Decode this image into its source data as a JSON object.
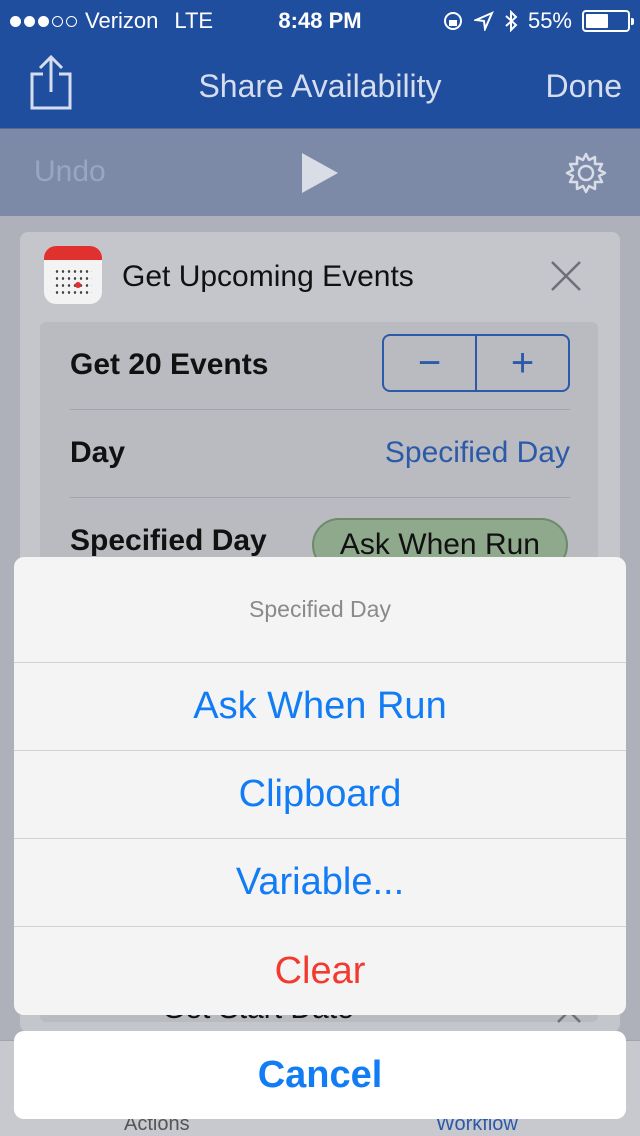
{
  "status_bar": {
    "carrier": "Verizon",
    "network": "LTE",
    "time": "8:48 PM",
    "battery": "55%",
    "battery_level": 0.55
  },
  "nav": {
    "title": "Share Availability",
    "done_label": "Done",
    "share_icon": "share-icon"
  },
  "toolbar": {
    "undo_label": "Undo",
    "play_icon": "play-icon",
    "settings_icon": "gear-icon"
  },
  "action_card": {
    "title": "Get Upcoming Events",
    "icon": "calendar-icon",
    "rows": {
      "count_label": "Get 20 Events",
      "stepper_minus": "−",
      "stepper_plus": "+",
      "day_label": "Day",
      "day_value": "Specified Day",
      "specified_day_label": "Specified Day",
      "specified_day_value": "Ask When Run"
    }
  },
  "next_card": {
    "title": "Get Start Date"
  },
  "tabs": {
    "actions": "Actions",
    "workflow": "Workflow"
  },
  "action_sheet": {
    "title": "Specified Day",
    "options": [
      "Ask When Run",
      "Clipboard",
      "Variable...",
      "Clear"
    ],
    "cancel_label": "Cancel",
    "colors": {
      "option": "#127cf5",
      "destructive": "#f33a2f"
    }
  }
}
